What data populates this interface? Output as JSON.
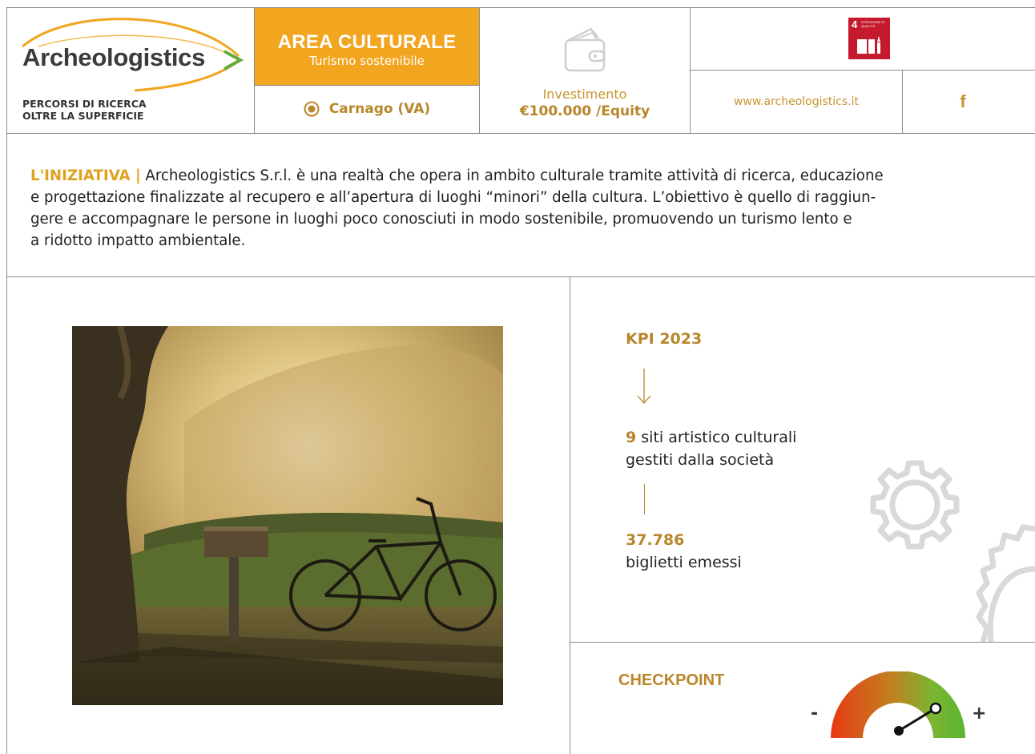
{
  "header": {
    "logo_name": "Archeologistics",
    "logo_tagline_1": "PERCORSI DI RICERCA",
    "logo_tagline_2": "OLTRE LA SUPERFICIE",
    "area_title": "AREA CULTURALE",
    "area_subtitle": "Turismo sostenibile",
    "location": "Carnago (VA)",
    "investment_label": "Investimento",
    "investment_value": "€100.000 /Equity",
    "sdg_number": "4",
    "sdg_text": "ISTRUZIONE DI QUALITÀ",
    "website": "www.archeologistics.it",
    "social": "f"
  },
  "intro": {
    "lead": "L'INIZIATIVA |",
    "line1": " Archeologistics S.r.l. è una realtà che opera in ambito culturale tramite attività di ricerca, educazione",
    "line2": "e progettazione finalizzate al recupero e all’apertura di luoghi “minori” della cultura. L’obiettivo è quello di raggiun-",
    "line3": "gere e accompagnare le persone in luoghi poco conosciuti in modo sostenibile, promuovendo un turismo lento e",
    "line4": "a ridotto impatto ambientale."
  },
  "kpi": {
    "title": "KPI 2023",
    "item1_number": "9",
    "item1_text_a": " siti artistico culturali",
    "item1_text_b": "gestiti dalla società",
    "item2_number": "37.786",
    "item2_text": "biglietti emessi"
  },
  "checkpoint": {
    "title": "CHECKPOINT",
    "minus": "-",
    "plus": "+",
    "level": 0.8
  },
  "colors": {
    "accent": "#f2a51e",
    "gold": "#b8862b",
    "sdg_red": "#c5192d"
  },
  "icons": [
    "wallet-icon",
    "location-pin-icon",
    "facebook-icon",
    "down-arrow-icon",
    "gear-icon",
    "gauge-icon",
    "book-icon"
  ]
}
